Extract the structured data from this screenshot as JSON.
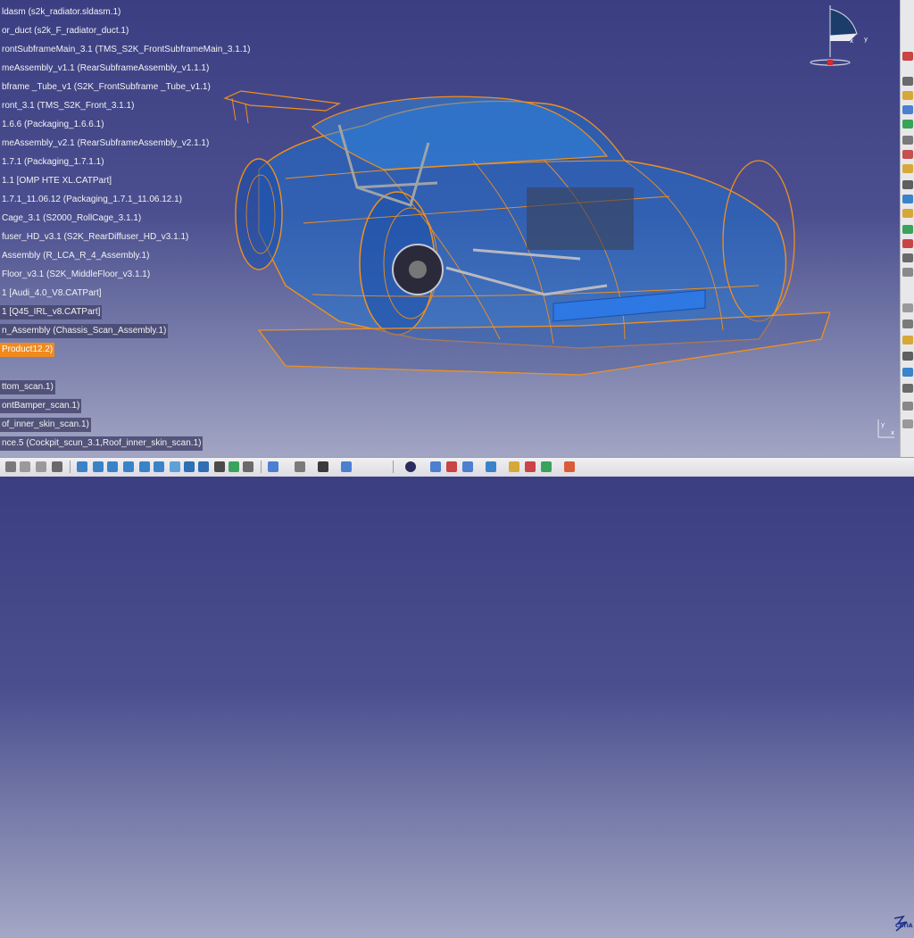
{
  "tree": {
    "items": [
      {
        "label": "ldasm (s2k_radiator.sldasm.1)",
        "style": "plain"
      },
      {
        "label": "or_duct (s2k_F_radiator_duct.1)",
        "style": "plain"
      },
      {
        "label": "rontSubframeMain_3.1 (TMS_S2K_FrontSubframeMain_3.1.1)",
        "style": "plain"
      },
      {
        "label": "meAssembly_v1.1 (RearSubframeAssembly_v1.1.1)",
        "style": "plain"
      },
      {
        "label": "bframe _Tube_v1 (S2K_FrontSubframe _Tube_v1.1)",
        "style": "plain"
      },
      {
        "label": "ront_3.1 (TMS_S2K_Front_3.1.1)",
        "style": "plain"
      },
      {
        "label": "1.6.6 (Packaging_1.6.6.1)",
        "style": "plain"
      },
      {
        "label": "meAssembly_v2.1 (RearSubframeAssembly_v2.1.1)",
        "style": "plain"
      },
      {
        "label": "1.7.1 (Packaging_1.7.1.1)",
        "style": "plain"
      },
      {
        "label": "1.1 [OMP HTE XL.CATPart]",
        "style": "plain"
      },
      {
        "label": "1.7.1_11.06.12 (Packaging_1.7.1_11.06.12.1)",
        "style": "plain"
      },
      {
        "label": "Cage_3.1 (S2000_RollCage_3.1.1)",
        "style": "plain"
      },
      {
        "label": "fuser_HD_v3.1 (S2K_RearDiffuser_HD_v3.1.1)",
        "style": "plain"
      },
      {
        "label": "Assembly (R_LCA_R_4_Assembly.1)",
        "style": "plain"
      },
      {
        "label": "Floor_v3.1 (S2K_MiddleFloor_v3.1.1)",
        "style": "plain"
      },
      {
        "label": "1 [Audi_4.0_V8.CATPart]",
        "style": "plain"
      },
      {
        "label": "1 [Q45_IRL_v8.CATPart]",
        "style": "dim"
      },
      {
        "label": "n_Assembly (Chassis_Scan_Assembly.1)",
        "style": "dim"
      },
      {
        "label": "Product12.2)",
        "style": "active"
      },
      {
        "label": "",
        "style": "none"
      },
      {
        "label": "ttom_scan.1)",
        "style": "dim"
      },
      {
        "label": "ontBamper_scan.1)",
        "style": "dim"
      },
      {
        "label": "of_inner_skin_scan.1)",
        "style": "dim"
      },
      {
        "label": "nce.5 (Cockpit_scun_3.1,Roof_inner_skin_scan.1)",
        "style": "dim"
      }
    ]
  },
  "compass": {
    "x_label": "x",
    "y_label": "y"
  },
  "small_axis": {
    "x_label": "x",
    "y_label": "y"
  },
  "logo": {
    "text": "CATIA"
  },
  "colors": {
    "background_top": "#3b3f82",
    "background_bottom": "#a9acc8",
    "wireframe": "#f0901e",
    "body_blue": "#1e6fd0",
    "tree_highlight": "#f08a1e"
  },
  "model": {
    "name": "car-wireframe-model"
  }
}
